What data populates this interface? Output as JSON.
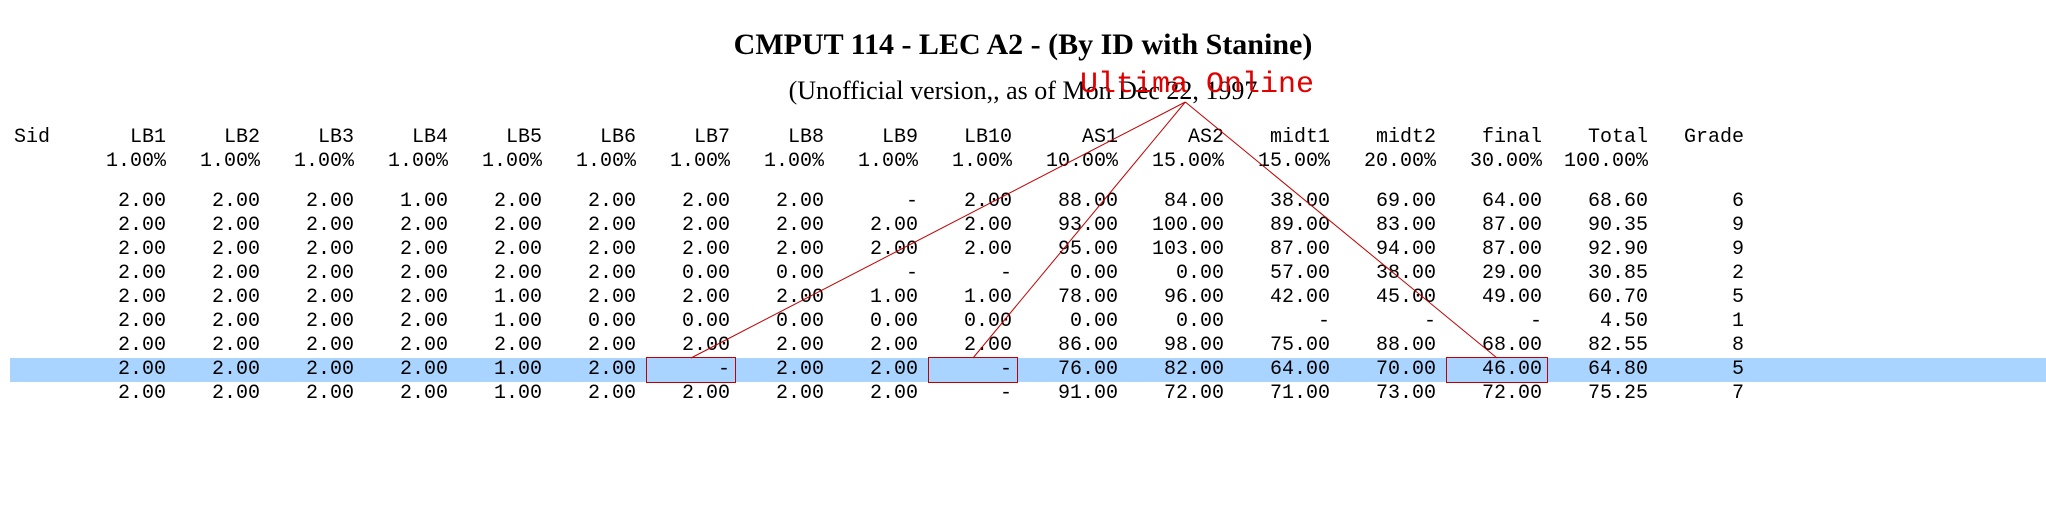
{
  "title": "CMPUT 114 - LEC A2 - (By ID with Stanine)",
  "subtitle": "(Unofficial version,, as of Mon Dec 22, 1997",
  "annotation": "Ultima Online",
  "headers": {
    "sid": "Sid",
    "cols": [
      "LB1",
      "LB2",
      "LB3",
      "LB4",
      "LB5",
      "LB6",
      "LB7",
      "LB8",
      "LB9",
      "LB10",
      "AS1",
      "AS2",
      "midt1",
      "midt2",
      "final",
      "Total",
      "Grade"
    ],
    "weights": [
      "1.00%",
      "1.00%",
      "1.00%",
      "1.00%",
      "1.00%",
      "1.00%",
      "1.00%",
      "1.00%",
      "1.00%",
      "1.00%",
      "10.00%",
      "15.00%",
      "15.00%",
      "20.00%",
      "30.00%",
      "100.00%",
      ""
    ]
  },
  "rows": [
    {
      "sid": "",
      "c": [
        "2.00",
        "2.00",
        "2.00",
        "1.00",
        "2.00",
        "2.00",
        "2.00",
        "2.00",
        "-",
        "2.00",
        "88.00",
        "84.00",
        "38.00",
        "69.00",
        "64.00",
        "68.60",
        "6"
      ],
      "hl": false
    },
    {
      "sid": "",
      "c": [
        "2.00",
        "2.00",
        "2.00",
        "2.00",
        "2.00",
        "2.00",
        "2.00",
        "2.00",
        "2.00",
        "2.00",
        "93.00",
        "100.00",
        "89.00",
        "83.00",
        "87.00",
        "90.35",
        "9"
      ],
      "hl": false
    },
    {
      "sid": "",
      "c": [
        "2.00",
        "2.00",
        "2.00",
        "2.00",
        "2.00",
        "2.00",
        "2.00",
        "2.00",
        "2.00",
        "2.00",
        "95.00",
        "103.00",
        "87.00",
        "94.00",
        "87.00",
        "92.90",
        "9"
      ],
      "hl": false
    },
    {
      "sid": "",
      "c": [
        "2.00",
        "2.00",
        "2.00",
        "2.00",
        "2.00",
        "2.00",
        "0.00",
        "0.00",
        "-",
        "-",
        "0.00",
        "0.00",
        "57.00",
        "38.00",
        "29.00",
        "30.85",
        "2"
      ],
      "hl": false
    },
    {
      "sid": "",
      "c": [
        "2.00",
        "2.00",
        "2.00",
        "2.00",
        "1.00",
        "2.00",
        "2.00",
        "2.00",
        "1.00",
        "1.00",
        "78.00",
        "96.00",
        "42.00",
        "45.00",
        "49.00",
        "60.70",
        "5"
      ],
      "hl": false
    },
    {
      "sid": "",
      "c": [
        "2.00",
        "2.00",
        "2.00",
        "2.00",
        "1.00",
        "0.00",
        "0.00",
        "0.00",
        "0.00",
        "0.00",
        "0.00",
        "0.00",
        "-",
        "-",
        "-",
        "4.50",
        "1"
      ],
      "hl": false
    },
    {
      "sid": "",
      "c": [
        "2.00",
        "2.00",
        "2.00",
        "2.00",
        "2.00",
        "2.00",
        "2.00",
        "2.00",
        "2.00",
        "2.00",
        "86.00",
        "98.00",
        "75.00",
        "88.00",
        "68.00",
        "82.55",
        "8"
      ],
      "hl": false
    },
    {
      "sid": "",
      "c": [
        "2.00",
        "2.00",
        "2.00",
        "2.00",
        "1.00",
        "2.00",
        "-",
        "2.00",
        "2.00",
        "-",
        "76.00",
        "82.00",
        "64.00",
        "70.00",
        "46.00",
        "64.80",
        "5"
      ],
      "hl": true
    },
    {
      "sid": "",
      "c": [
        "2.00",
        "2.00",
        "2.00",
        "2.00",
        "1.00",
        "2.00",
        "2.00",
        "2.00",
        "2.00",
        "-",
        "91.00",
        "72.00",
        "71.00",
        "73.00",
        "72.00",
        "75.25",
        "7"
      ],
      "hl": false
    }
  ],
  "redBoxes": [
    {
      "row": 7,
      "col": 6
    },
    {
      "row": 7,
      "col": 9
    },
    {
      "row": 7,
      "col": 14
    }
  ]
}
